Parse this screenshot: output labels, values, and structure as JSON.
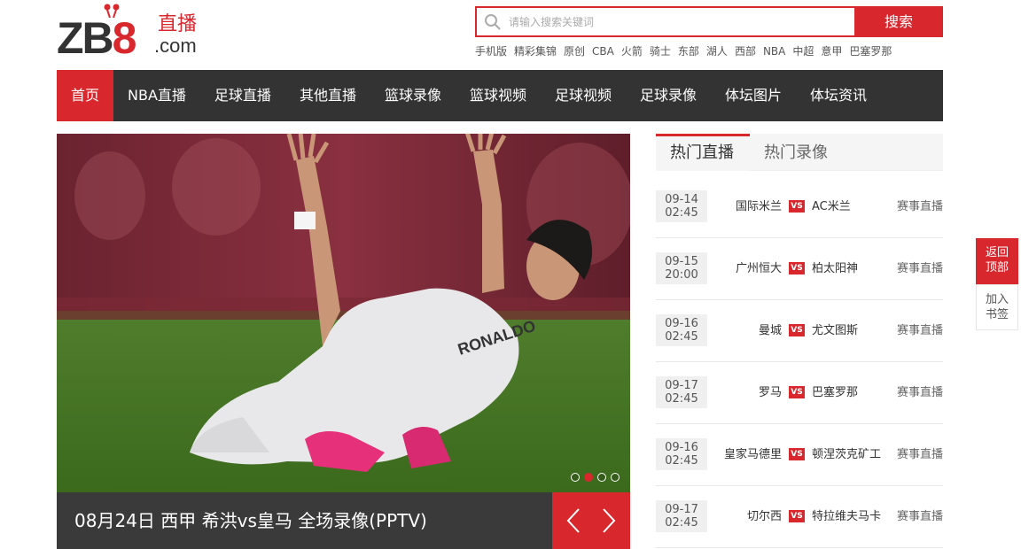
{
  "logo": {
    "main_left": "ZB",
    "main_mid": "8",
    "zhi_bo": "直播",
    "domain": ".com"
  },
  "search": {
    "placeholder": "请输入搜索关键词",
    "button": "搜索"
  },
  "hotwords": [
    "手机版",
    "精彩集锦",
    "原创",
    "CBA",
    "火箭",
    "骑士",
    "东部",
    "湖人",
    "西部",
    "NBA",
    "中超",
    "意甲",
    "巴塞罗那"
  ],
  "nav": [
    "首页",
    "NBA直播",
    "足球直播",
    "其他直播",
    "篮球录像",
    "篮球视频",
    "足球视频",
    "足球录像",
    "体坛图片",
    "体坛资讯"
  ],
  "slider": {
    "caption": "08月24日 西甲 希洪vs皇马 全场录像(PPTV)",
    "active_dot": 1,
    "dot_count": 4,
    "jersey_text": "RONALDO"
  },
  "tabs": [
    "热门直播",
    "热门录像"
  ],
  "matches": [
    {
      "date": "09-14",
      "time": "02:45",
      "home": "国际米兰",
      "vs": "VS",
      "away": "AC米兰",
      "link": "赛事直播"
    },
    {
      "date": "09-15",
      "time": "20:00",
      "home": "广州恒大",
      "vs": "VS",
      "away": "柏太阳神",
      "link": "赛事直播"
    },
    {
      "date": "09-16",
      "time": "02:45",
      "home": "曼城",
      "vs": "VS",
      "away": "尤文图斯",
      "link": "赛事直播"
    },
    {
      "date": "09-17",
      "time": "02:45",
      "home": "罗马",
      "vs": "VS",
      "away": "巴塞罗那",
      "link": "赛事直播"
    },
    {
      "date": "09-16",
      "time": "02:45",
      "home": "皇家马德里",
      "vs": "VS",
      "away": "顿涅茨克矿工",
      "link": "赛事直播"
    },
    {
      "date": "09-17",
      "time": "02:45",
      "home": "切尔西",
      "vs": "VS",
      "away": "特拉维夫马卡",
      "link": "赛事直播"
    }
  ],
  "float": {
    "totop_1": "返回",
    "totop_2": "顶部",
    "fav_1": "加入",
    "fav_2": "书签"
  },
  "colors": {
    "accent": "#d9272e",
    "nav_bg": "#333333",
    "caption_bg": "#3a3a3a"
  }
}
